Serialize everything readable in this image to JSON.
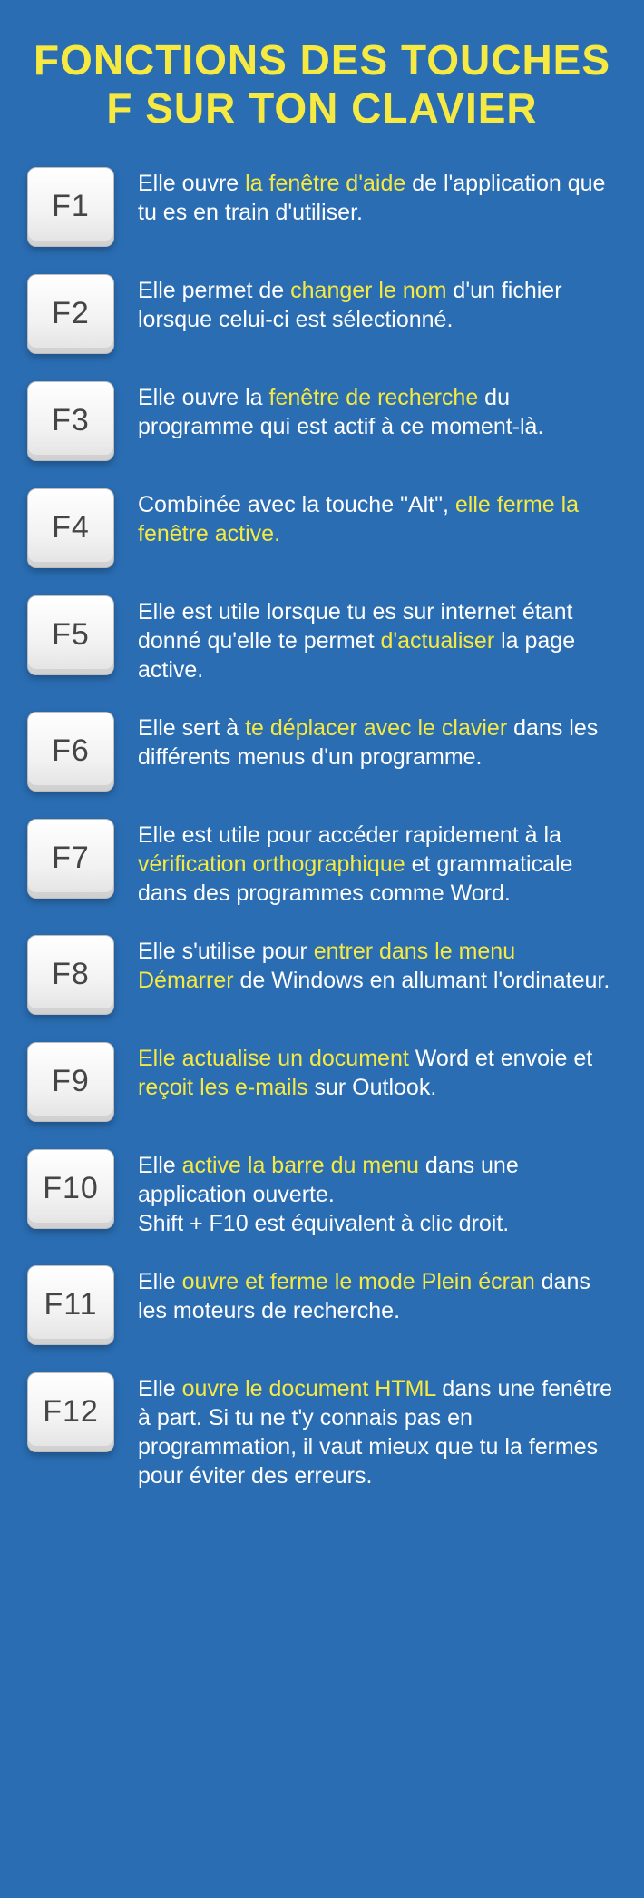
{
  "title": "FONCTIONS DES TOUCHES F SUR TON CLAVIER",
  "keys": [
    {
      "label": "F1",
      "parts": [
        {
          "t": "Elle ouvre ",
          "hl": false
        },
        {
          "t": "la fenêtre d'aide",
          "hl": true
        },
        {
          "t": " de l'application que tu es en train d'utiliser.",
          "hl": false
        }
      ]
    },
    {
      "label": "F2",
      "parts": [
        {
          "t": "Elle permet de ",
          "hl": false
        },
        {
          "t": "changer le nom",
          "hl": true
        },
        {
          "t": " d'un fichier lorsque celui-ci est sélectionné.",
          "hl": false
        }
      ]
    },
    {
      "label": "F3",
      "parts": [
        {
          "t": "Elle ouvre la ",
          "hl": false
        },
        {
          "t": "fenêtre de recherche",
          "hl": true
        },
        {
          "t": " du programme qui est actif à ce moment-là.",
          "hl": false
        }
      ]
    },
    {
      "label": "F4",
      "parts": [
        {
          "t": "Combinée avec la touche \"Alt\", ",
          "hl": false
        },
        {
          "t": "elle ferme la fenêtre active.",
          "hl": true
        }
      ]
    },
    {
      "label": "F5",
      "parts": [
        {
          "t": "Elle est utile lorsque tu es sur internet étant donné qu'elle te permet ",
          "hl": false
        },
        {
          "t": "d'actualiser",
          "hl": true
        },
        {
          "t": " la page active.",
          "hl": false
        }
      ]
    },
    {
      "label": "F6",
      "parts": [
        {
          "t": "Elle sert à ",
          "hl": false
        },
        {
          "t": "te déplacer avec le clavier",
          "hl": true
        },
        {
          "t": " dans les différents menus d'un programme.",
          "hl": false
        }
      ]
    },
    {
      "label": "F7",
      "parts": [
        {
          "t": "Elle est utile pour accéder rapidement à la ",
          "hl": false
        },
        {
          "t": "vérification orthographique",
          "hl": true
        },
        {
          "t": " et grammaticale dans des programmes comme Word.",
          "hl": false
        }
      ]
    },
    {
      "label": "F8",
      "parts": [
        {
          "t": "Elle s'utilise pour ",
          "hl": false
        },
        {
          "t": "entrer dans le menu Démarrer",
          "hl": true
        },
        {
          "t": " de Windows en allumant l'ordinateur.",
          "hl": false
        }
      ]
    },
    {
      "label": "F9",
      "parts": [
        {
          "t": "Elle actualise un document",
          "hl": true
        },
        {
          "t": " Word et envoie et ",
          "hl": false
        },
        {
          "t": "reçoit les e-mails",
          "hl": true
        },
        {
          "t": " sur Outlook.",
          "hl": false
        }
      ]
    },
    {
      "label": "F10",
      "parts": [
        {
          "t": "Elle ",
          "hl": false
        },
        {
          "t": "active la barre du menu",
          "hl": true
        },
        {
          "t": " dans une application ouverte.",
          "hl": false
        },
        {
          "t": "\n",
          "hl": false
        },
        {
          "t": "Shift + F10 est équivalent à clic droit.",
          "hl": false
        }
      ]
    },
    {
      "label": "F11",
      "parts": [
        {
          "t": "Elle ",
          "hl": false
        },
        {
          "t": "ouvre et ferme le mode Plein écran",
          "hl": true
        },
        {
          "t": " dans les moteurs de recherche.",
          "hl": false
        }
      ]
    },
    {
      "label": "F12",
      "parts": [
        {
          "t": "Elle ",
          "hl": false
        },
        {
          "t": "ouvre le document HTML",
          "hl": true
        },
        {
          "t": " dans une fenêtre à part. Si tu ne t'y connais pas en programmation, il vaut mieux que tu la fermes pour éviter des erreurs.",
          "hl": false
        }
      ]
    }
  ]
}
